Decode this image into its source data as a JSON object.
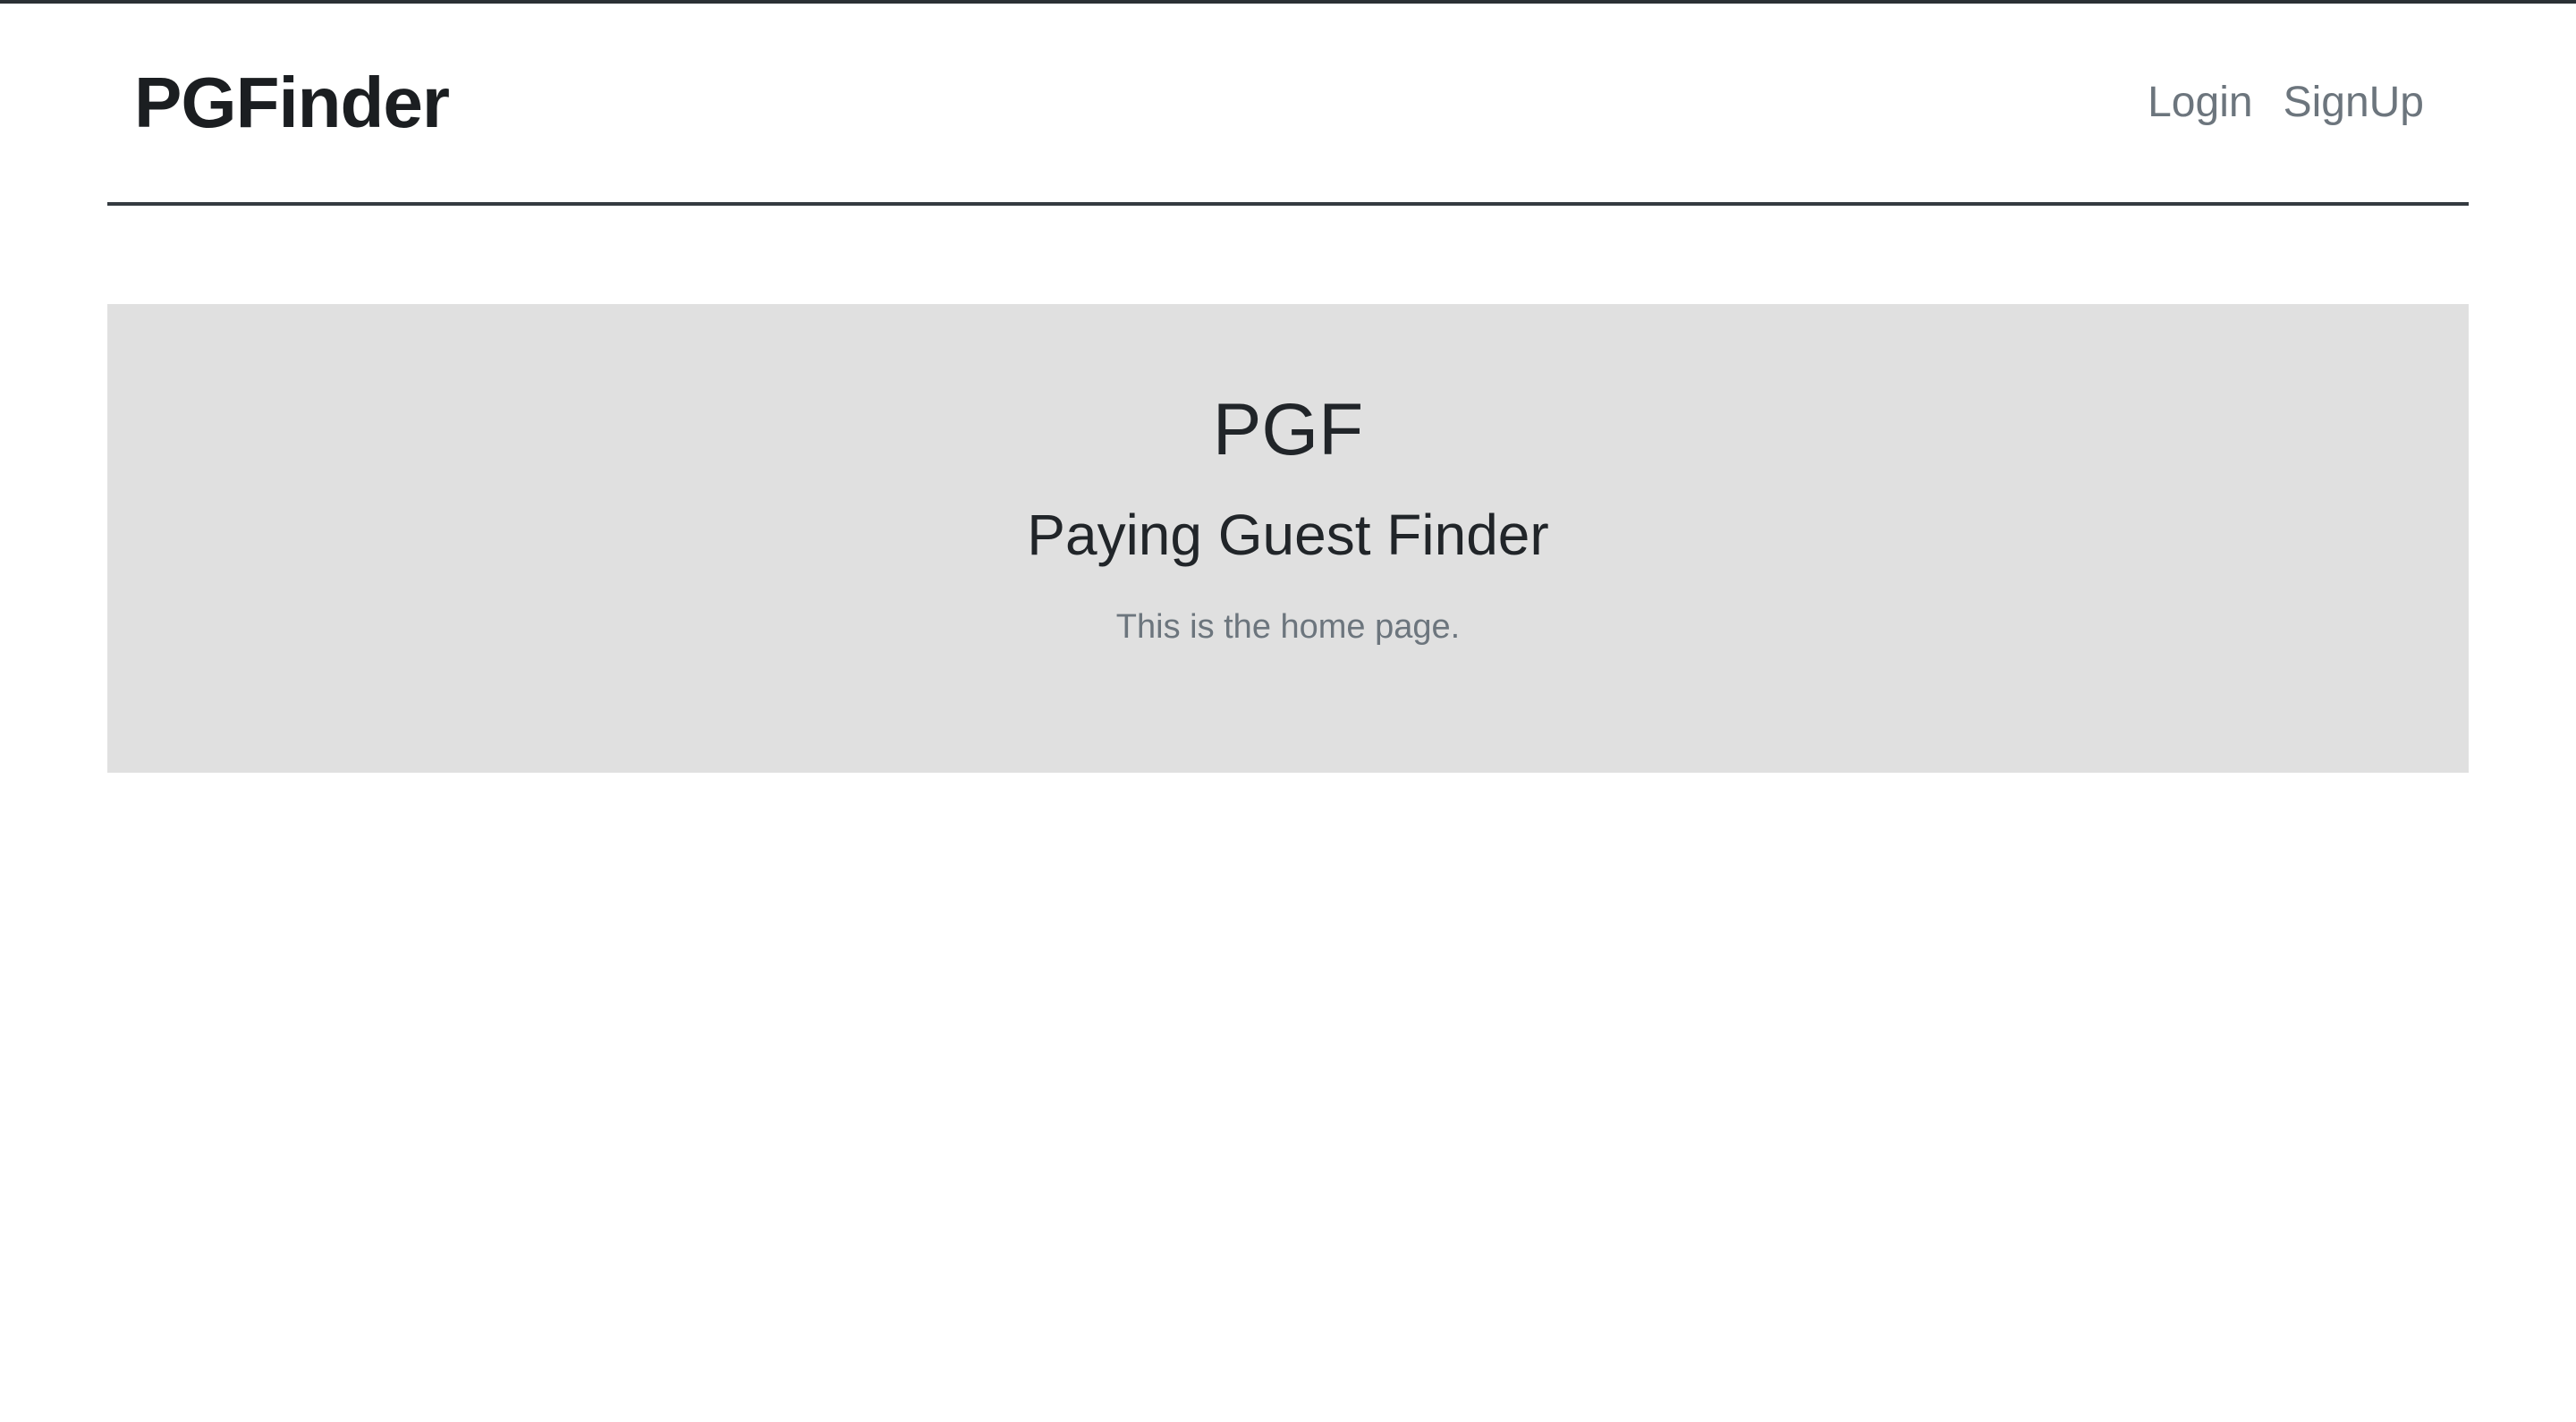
{
  "navbar": {
    "brand": "PGFinder",
    "links": [
      {
        "label": "Login"
      },
      {
        "label": "SignUp"
      }
    ]
  },
  "hero": {
    "title": "PGF",
    "subtitle": "Paying Guest Finder",
    "text": "This is the home page."
  },
  "colors": {
    "hero_background": "#e0e0e0",
    "navbar_border": "#343a40",
    "link_color": "#6c757d"
  }
}
